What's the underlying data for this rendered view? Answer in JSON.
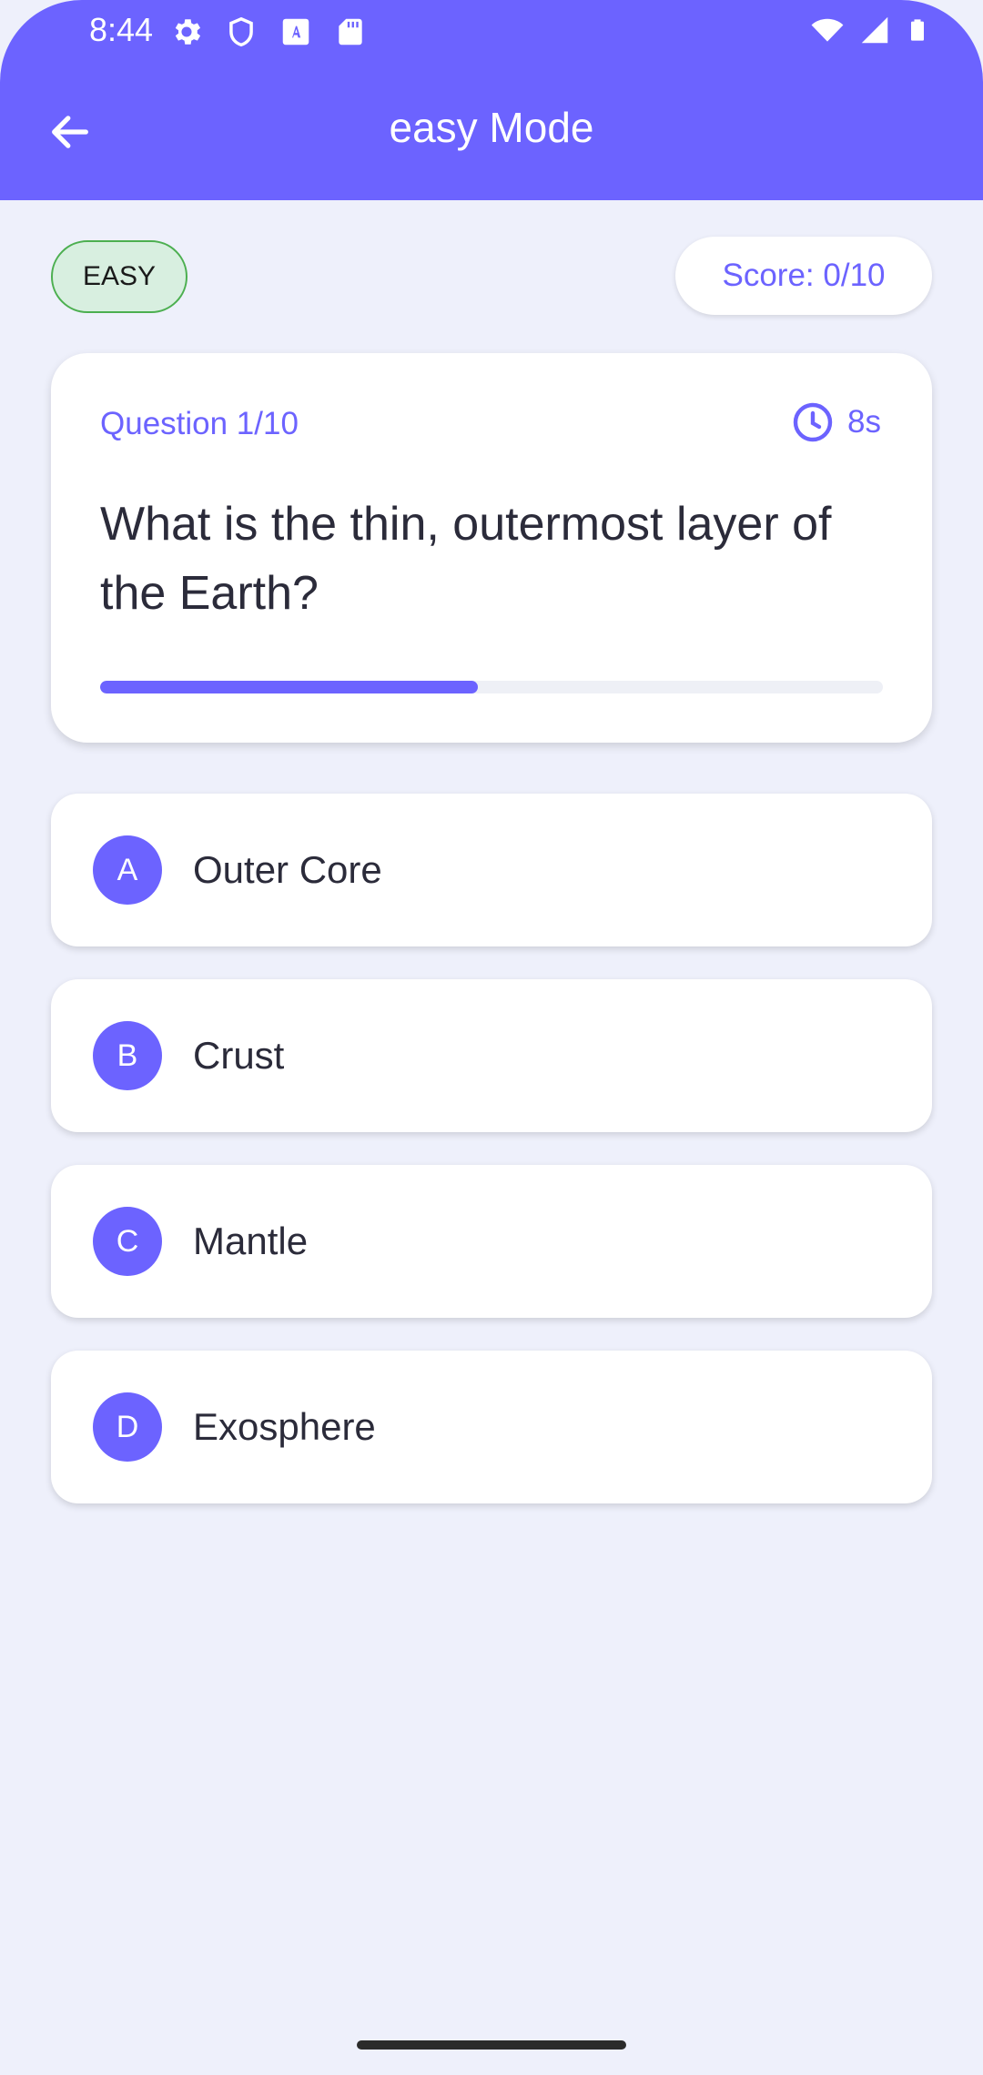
{
  "status_bar": {
    "time": "8:44",
    "left_icons": [
      "settings-icon",
      "shield-icon",
      "text-a-icon",
      "sd-card-icon"
    ],
    "right_icons": [
      "wifi-icon",
      "signal-icon",
      "battery-icon"
    ]
  },
  "app_bar": {
    "title": "easy Mode",
    "back_icon": "arrow-back-icon"
  },
  "difficulty": "EASY",
  "score": "Score: 0/10",
  "question": {
    "number": "Question 1/10",
    "timer": "8s",
    "timer_icon": "clock-icon",
    "text": "What is the thin, outermost layer of the Earth?",
    "progress": 0.483
  },
  "options": [
    {
      "letter": "A",
      "text": "Outer Core"
    },
    {
      "letter": "B",
      "text": "Crust"
    },
    {
      "letter": "C",
      "text": "Mantle"
    },
    {
      "letter": "D",
      "text": "Exosphere"
    }
  ],
  "colors": {
    "primary": "#6c63ff",
    "background": "#eef0fb",
    "easy_green": "#4caf50"
  }
}
